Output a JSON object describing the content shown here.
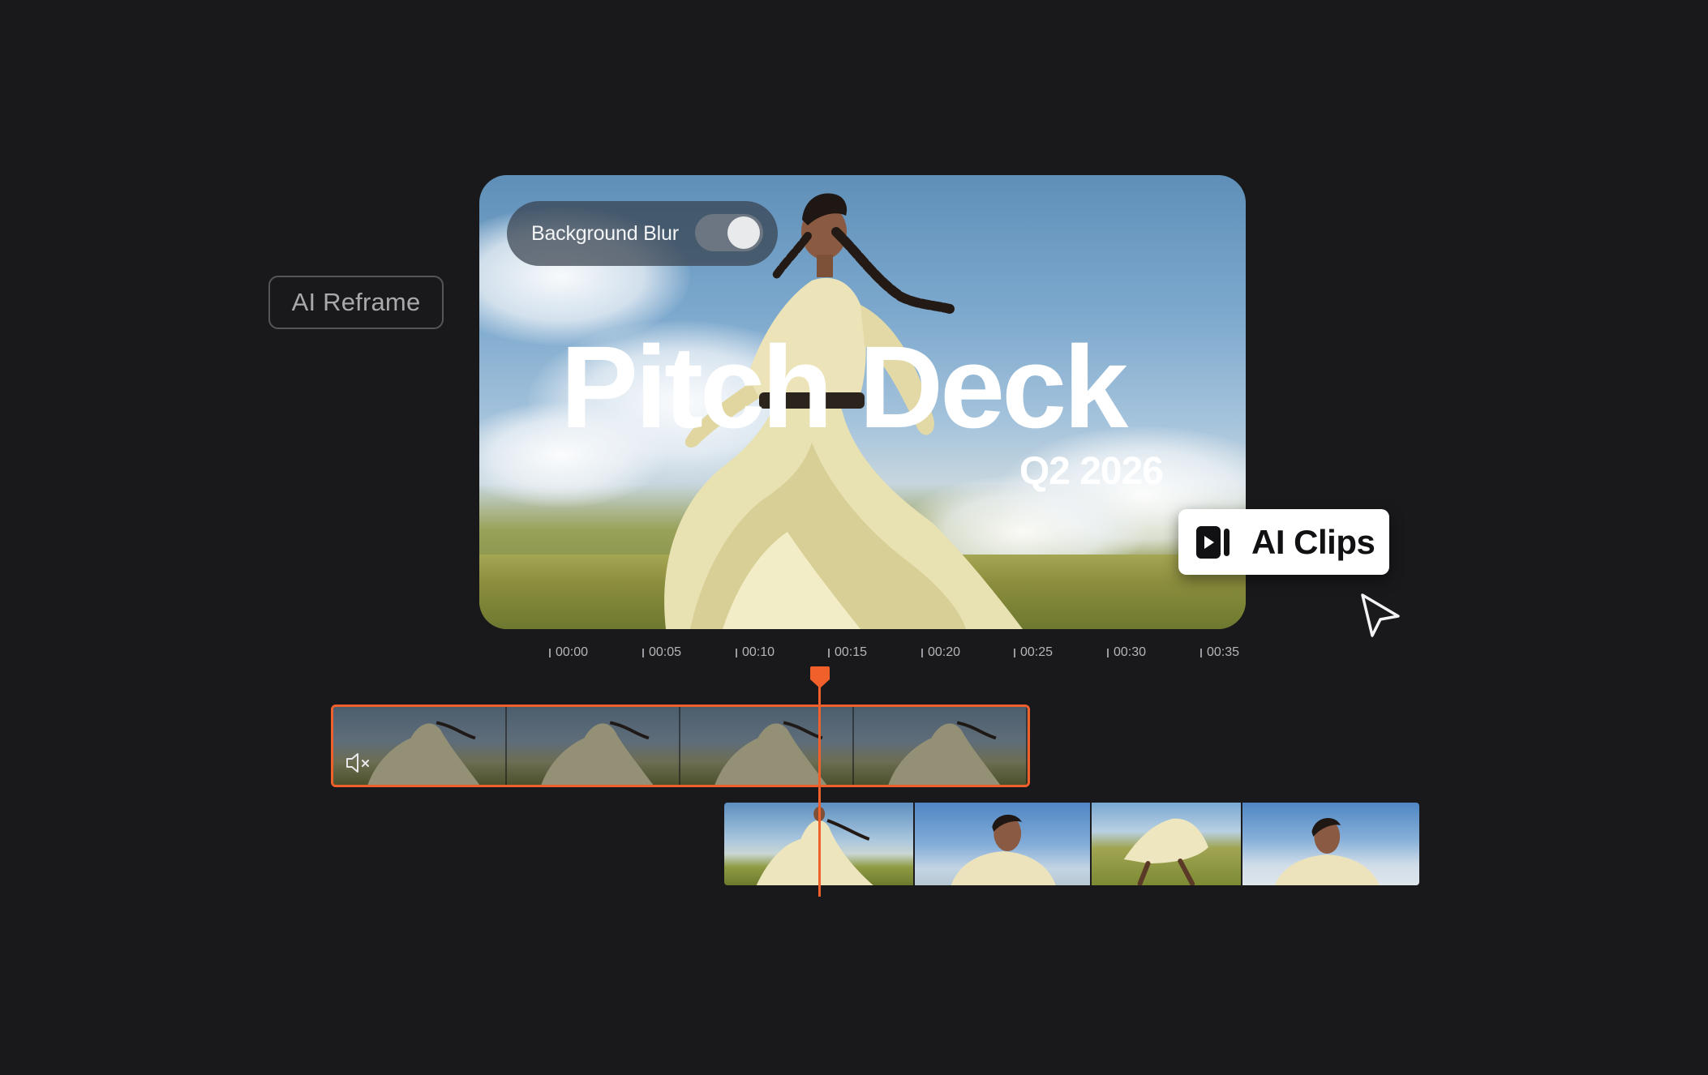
{
  "reframe_chip": {
    "label": "AI Reframe"
  },
  "preview": {
    "background_blur": {
      "label": "Background Blur",
      "enabled": true
    },
    "title": "Pitch Deck",
    "subtitle": "Q2 2026"
  },
  "clips_button": {
    "label": "AI Clips",
    "icon": "clips-play-icon"
  },
  "cursor": {
    "icon": "cursor-arrow-icon"
  },
  "timeline": {
    "ticks": [
      "00:00",
      "00:05",
      "00:10",
      "00:15",
      "00:20",
      "00:25",
      "00:30",
      "00:35"
    ],
    "playhead_time": "00:15",
    "accent_color": "#f0602a"
  },
  "tracks": {
    "primary": {
      "muted": true,
      "icon": "speaker-muted-icon",
      "frame_count": 4
    },
    "secondary": {
      "frame_count": 4
    }
  }
}
